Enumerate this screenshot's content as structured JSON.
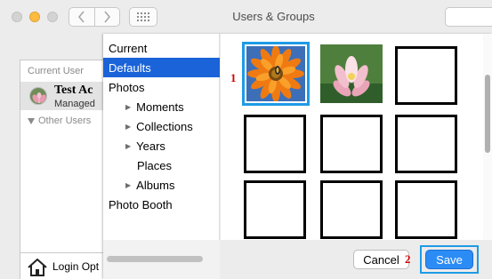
{
  "window": {
    "title": "Users & Groups"
  },
  "background_panel": {
    "current_user_label": "Current User",
    "user_name": "Test Ac",
    "user_status": "Managed",
    "other_users_label": "Other Users",
    "login_options_label": "Login Opt"
  },
  "picker": {
    "sources": [
      {
        "label": "Current",
        "level": 0,
        "selected": false,
        "expandable": false
      },
      {
        "label": "Defaults",
        "level": 0,
        "selected": true,
        "expandable": false
      },
      {
        "label": "Photos",
        "level": 0,
        "selected": false,
        "expandable": false
      },
      {
        "label": "Moments",
        "level": 1,
        "selected": false,
        "expandable": true
      },
      {
        "label": "Collections",
        "level": 1,
        "selected": false,
        "expandable": true
      },
      {
        "label": "Years",
        "level": 1,
        "selected": false,
        "expandable": true
      },
      {
        "label": "Places",
        "level": 1,
        "selected": false,
        "expandable": false
      },
      {
        "label": "Albums",
        "level": 1,
        "selected": false,
        "expandable": true
      },
      {
        "label": "Photo Booth",
        "level": 0,
        "selected": false,
        "expandable": false
      }
    ],
    "images": [
      {
        "kind": "photo",
        "subject": "orange-gerbera-with-bee",
        "selected": true
      },
      {
        "kind": "photo",
        "subject": "pink-lotus",
        "selected": false
      },
      {
        "kind": "empty"
      },
      {
        "kind": "empty"
      },
      {
        "kind": "empty"
      },
      {
        "kind": "empty"
      },
      {
        "kind": "empty"
      },
      {
        "kind": "empty"
      },
      {
        "kind": "empty"
      }
    ],
    "cancel_label": "Cancel",
    "save_label": "Save"
  },
  "annotations": {
    "marker_1": "1",
    "marker_2": "2"
  },
  "colors": {
    "selection": "#1a63d8",
    "highlight_box": "#1e9be6",
    "save_button": "#2c8cf5",
    "marker": "#d20000"
  },
  "icons": [
    "back-icon",
    "forward-icon",
    "grid-icon",
    "house-icon",
    "triangle-down-icon",
    "disclosure-triangle-icon"
  ]
}
